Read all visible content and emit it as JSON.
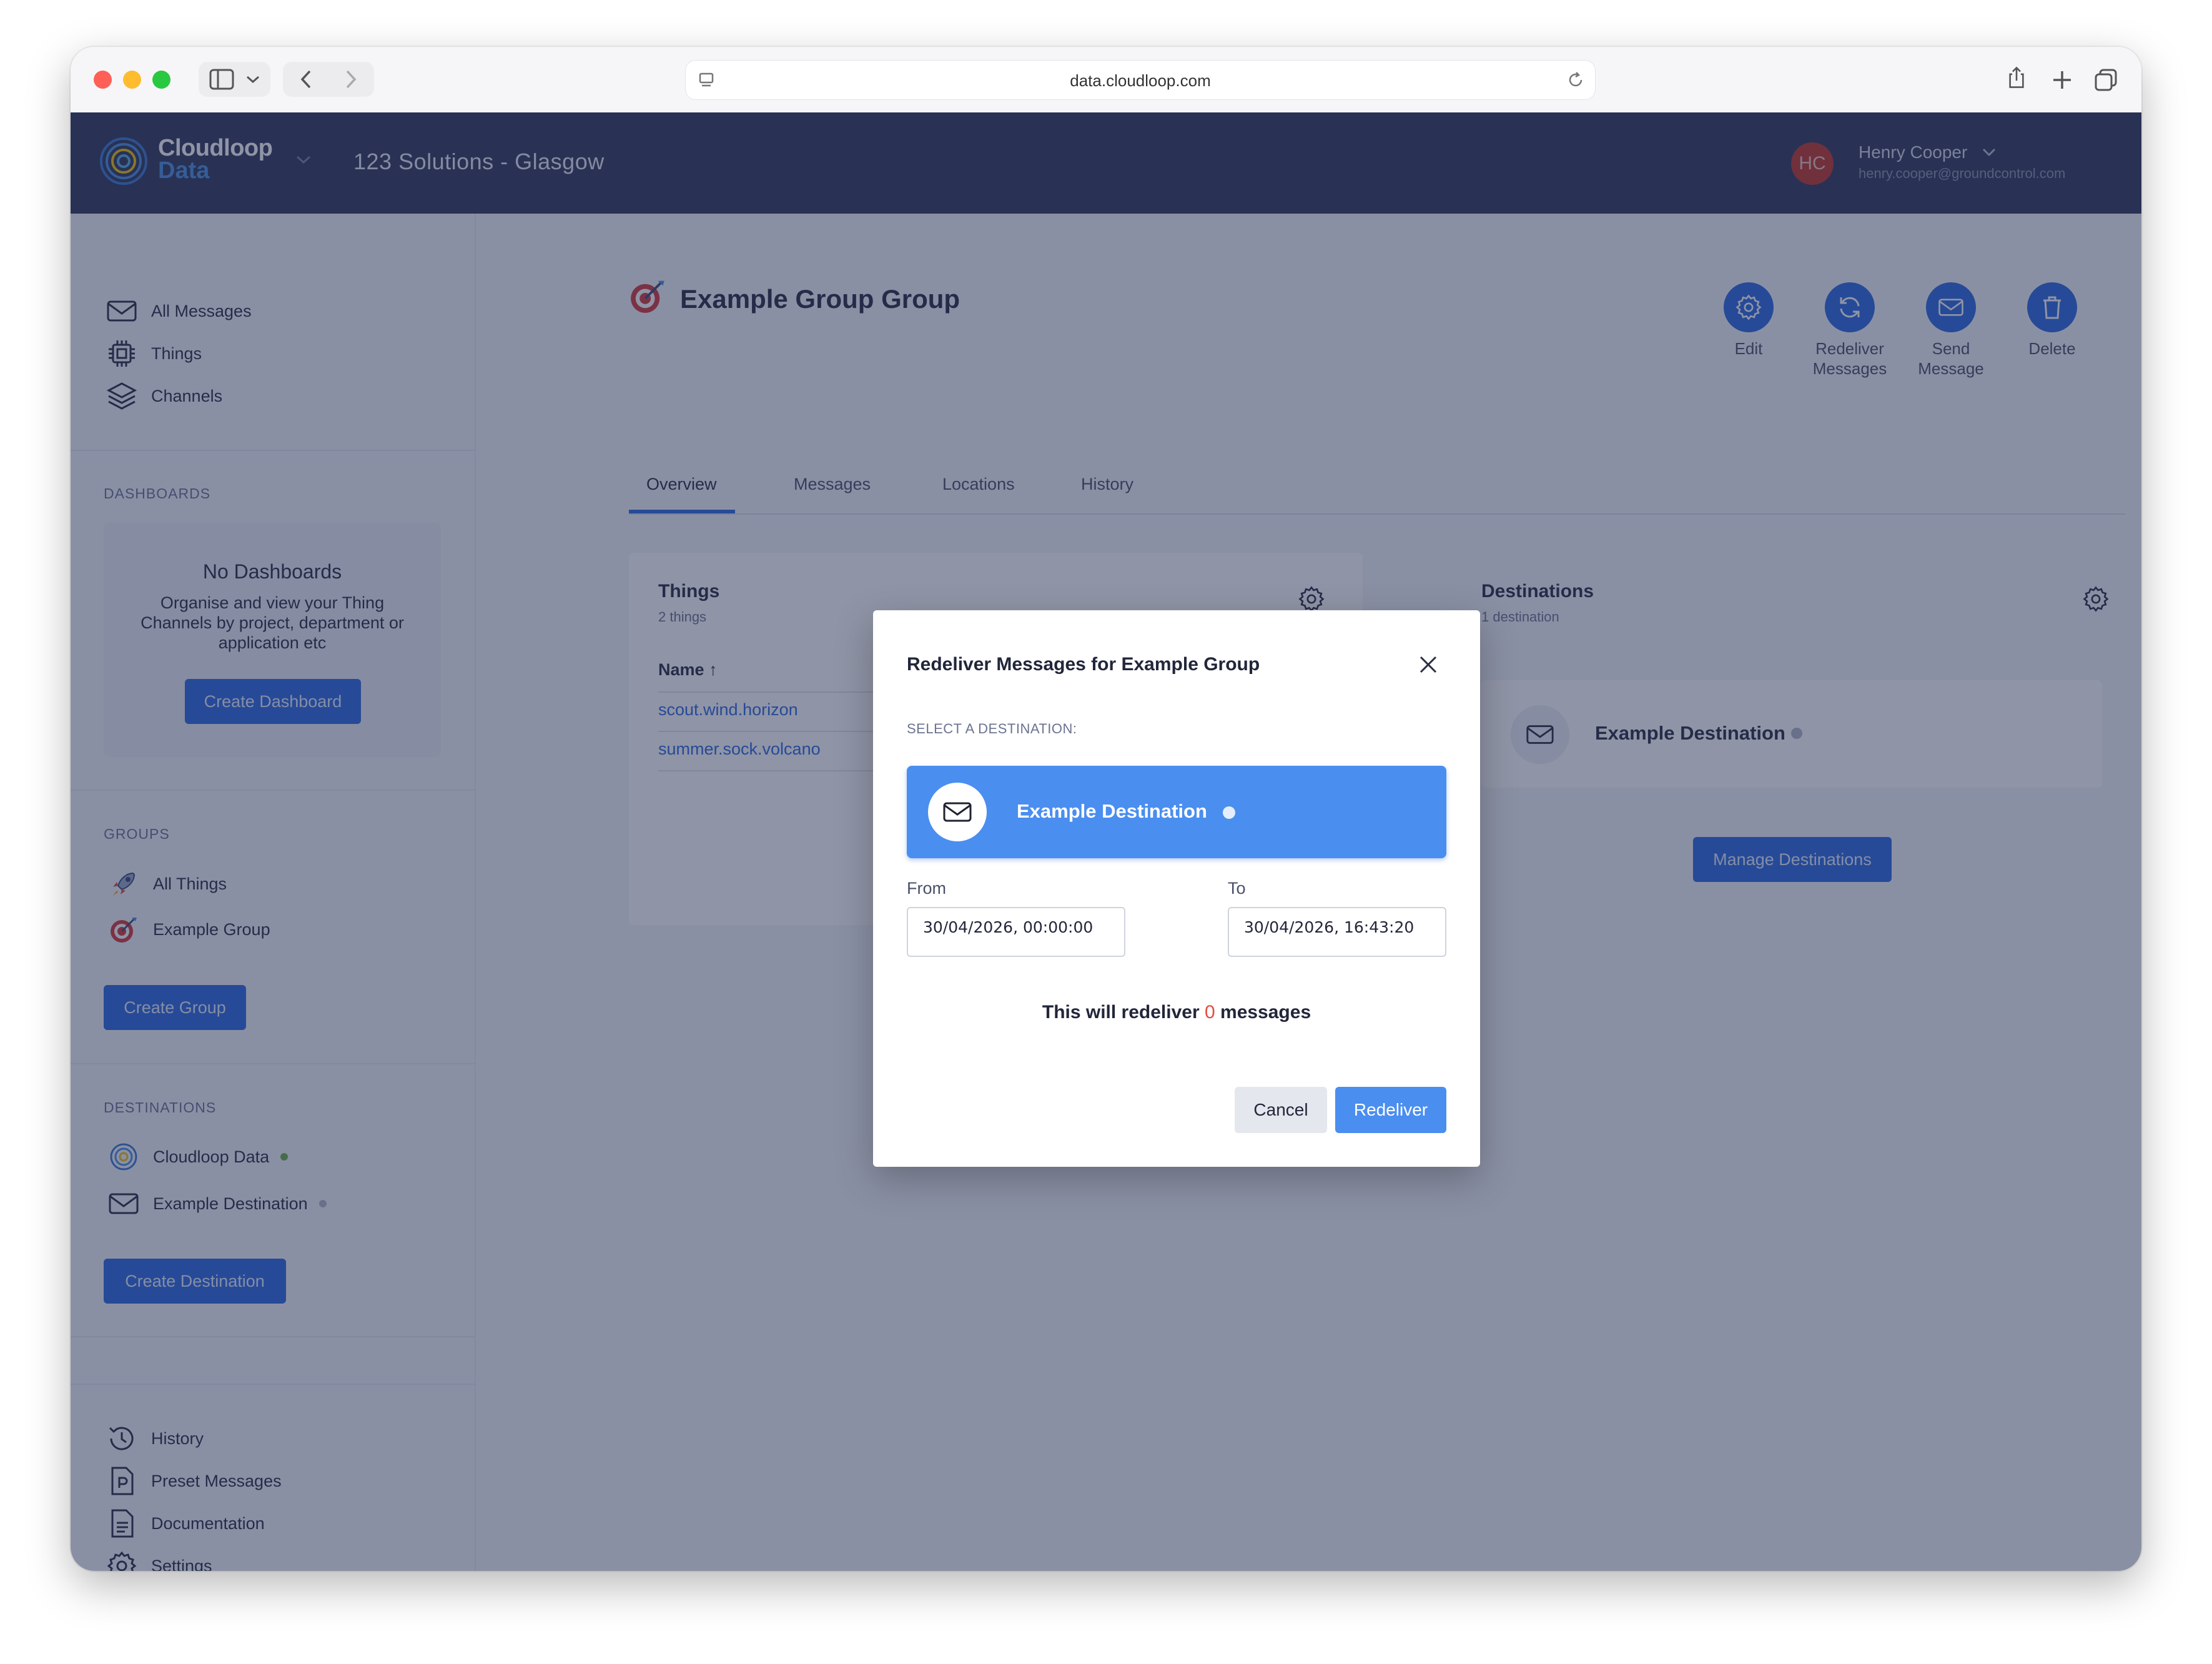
{
  "browser": {
    "url": "data.cloudloop.com"
  },
  "header": {
    "logo_line1": "Cloudloop",
    "logo_line2": "Data",
    "org_name": "123 Solutions - Glasgow",
    "avatar_initials": "HC",
    "user_name": "Henry Cooper",
    "user_email": "henry.cooper@groundcontrol.com"
  },
  "sidebar": {
    "main_items": [
      {
        "label": "All Messages",
        "icon": "envelope-icon"
      },
      {
        "label": "Things",
        "icon": "chip-icon"
      },
      {
        "label": "Channels",
        "icon": "layers-icon"
      }
    ],
    "dashboards": {
      "title": "DASHBOARDS",
      "empty_title": "No Dashboards",
      "empty_desc": "Organise and view your Thing Channels by project, department or application etc",
      "create_label": "Create Dashboard"
    },
    "groups": {
      "title": "GROUPS",
      "items": [
        {
          "label": "All Things",
          "icon": "rocket-icon"
        },
        {
          "label": "Example Group",
          "icon": "target-icon"
        }
      ],
      "create_label": "Create Group"
    },
    "destinations": {
      "title": "DESTINATIONS",
      "items": [
        {
          "label": "Cloudloop Data",
          "icon": "cloudloop-icon",
          "status_color": "#6ab04c"
        },
        {
          "label": "Example Destination",
          "icon": "envelope-icon",
          "status_color": "#b0b6c8"
        }
      ],
      "create_label": "Create Destination"
    },
    "footer_items": [
      {
        "label": "History",
        "icon": "history-icon"
      },
      {
        "label": "Preset Messages",
        "icon": "preset-doc-icon"
      },
      {
        "label": "Documentation",
        "icon": "document-icon"
      },
      {
        "label": "Settings",
        "icon": "gear-icon"
      }
    ]
  },
  "main": {
    "title": "Example Group Group",
    "actions": [
      {
        "label": "Edit",
        "icon": "gear-icon"
      },
      {
        "label": "Redeliver Messages",
        "icon": "refresh-icon"
      },
      {
        "label": "Send Message",
        "icon": "envelope-icon"
      },
      {
        "label": "Delete",
        "icon": "trash-icon"
      }
    ],
    "tabs": [
      "Overview",
      "Messages",
      "Locations",
      "History"
    ],
    "active_tab": "Overview",
    "things_card": {
      "title": "Things",
      "subtitle": "2 things",
      "column": "Name",
      "rows": [
        "scout.wind.horizon",
        "summer.sock.volcano"
      ]
    },
    "destinations_card": {
      "title": "Destinations",
      "subtitle": "1 destination",
      "item": "Example Destination",
      "manage_label": "Manage Destinations"
    }
  },
  "modal": {
    "title": "Redeliver Messages for Example Group",
    "select_label": "SELECT A DESTINATION:",
    "destination": "Example Destination",
    "from_label": "From",
    "from_value": "30/04/2026, 00:00:00",
    "to_label": "To",
    "to_value": "30/04/2026, 16:43:20",
    "summary_prefix": "This will redeliver",
    "summary_count": "0",
    "summary_suffix": "messages",
    "cancel_label": "Cancel",
    "redeliver_label": "Redeliver"
  },
  "colors": {
    "header_bg": "#333a5a",
    "primary": "#2d6ae0",
    "selected_option": "#4a8ef0",
    "count_red": "#e74c3c"
  }
}
